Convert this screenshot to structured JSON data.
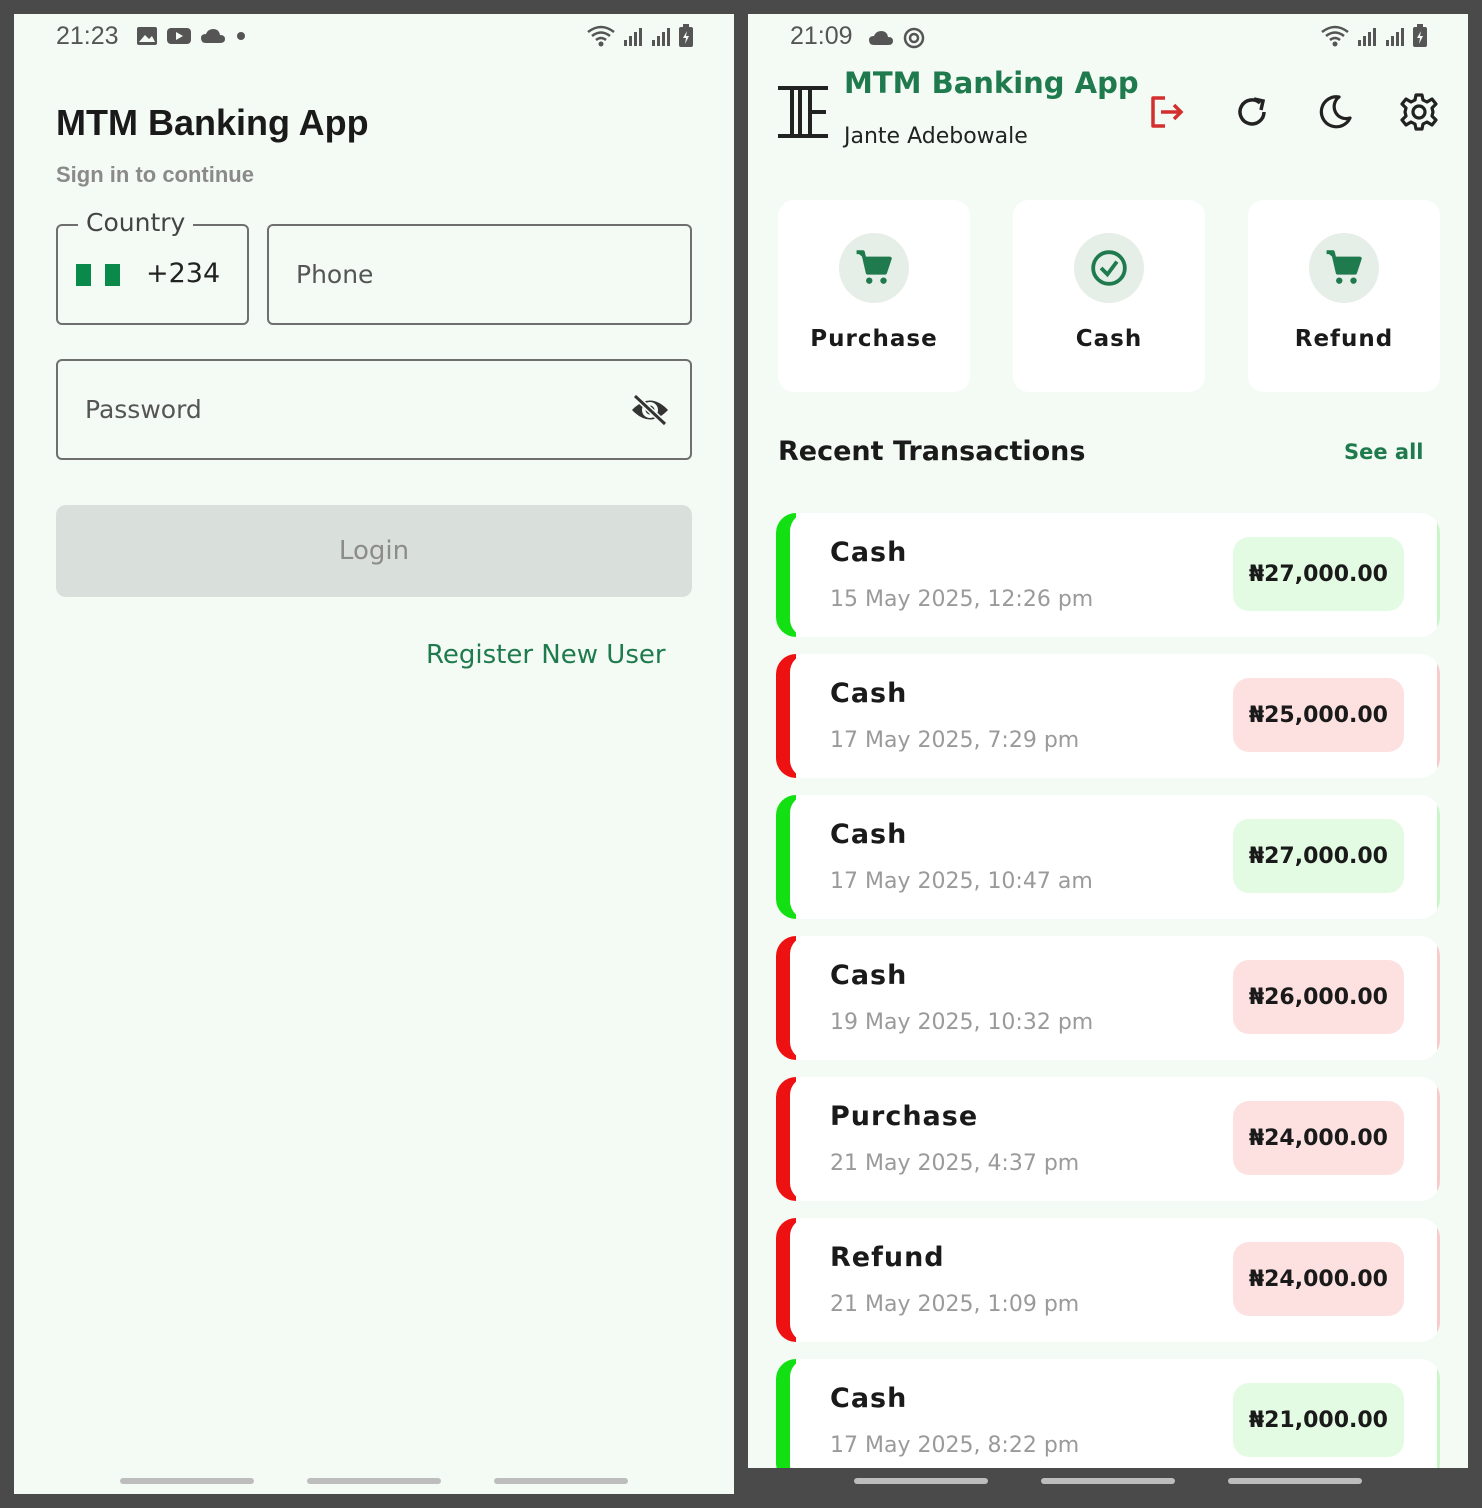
{
  "login_screen": {
    "status": {
      "time": "21:23"
    },
    "title": "MTM Banking App",
    "subtitle": "Sign in to continue",
    "country": {
      "legend": "Country",
      "code": "+234",
      "flag": "nigeria-flag"
    },
    "phone": {
      "placeholder": "Phone"
    },
    "password": {
      "placeholder": "Password"
    },
    "login_button": "Login",
    "register_link": "Register New User"
  },
  "home_screen": {
    "status": {
      "time": "21:09"
    },
    "app_title": "MTM Banking App",
    "user_name": "Jante Adebowale",
    "header_icons": [
      "logout-icon",
      "refresh-icon",
      "dark-mode-icon",
      "settings-icon"
    ],
    "actions": [
      {
        "label": "Purchase",
        "icon": "cart-icon"
      },
      {
        "label": "Cash",
        "icon": "check-circle-icon"
      },
      {
        "label": "Refund",
        "icon": "cart-icon"
      }
    ],
    "recent_title": "Recent Transactions",
    "see_all": "See all",
    "transactions": [
      {
        "type": "Cash",
        "date": "15 May 2025, 12:26 pm",
        "amount": "₦27,000.00",
        "status": "credit"
      },
      {
        "type": "Cash",
        "date": "17 May 2025, 7:29 pm",
        "amount": "₦25,000.00",
        "status": "debit"
      },
      {
        "type": "Cash",
        "date": "17 May 2025, 10:47 am",
        "amount": "₦27,000.00",
        "status": "credit"
      },
      {
        "type": "Cash",
        "date": "19 May 2025, 10:32 pm",
        "amount": "₦26,000.00",
        "status": "debit"
      },
      {
        "type": "Purchase",
        "date": "21 May 2025, 4:37 pm",
        "amount": "₦24,000.00",
        "status": "debit"
      },
      {
        "type": "Refund",
        "date": "21 May 2025, 1:09 pm",
        "amount": "₦24,000.00",
        "status": "debit"
      },
      {
        "type": "Cash",
        "date": "17 May 2025, 8:22 pm",
        "amount": "₦21,000.00",
        "status": "credit"
      }
    ]
  },
  "colors": {
    "brand_green": "#1f7a4d",
    "credit_bar": "#12e012",
    "debit_bar": "#ee1111",
    "credit_badge": "#e3fbe3",
    "debit_badge": "#fde1e1",
    "logout": "#d32f2f",
    "background": "#f3fbf4"
  }
}
